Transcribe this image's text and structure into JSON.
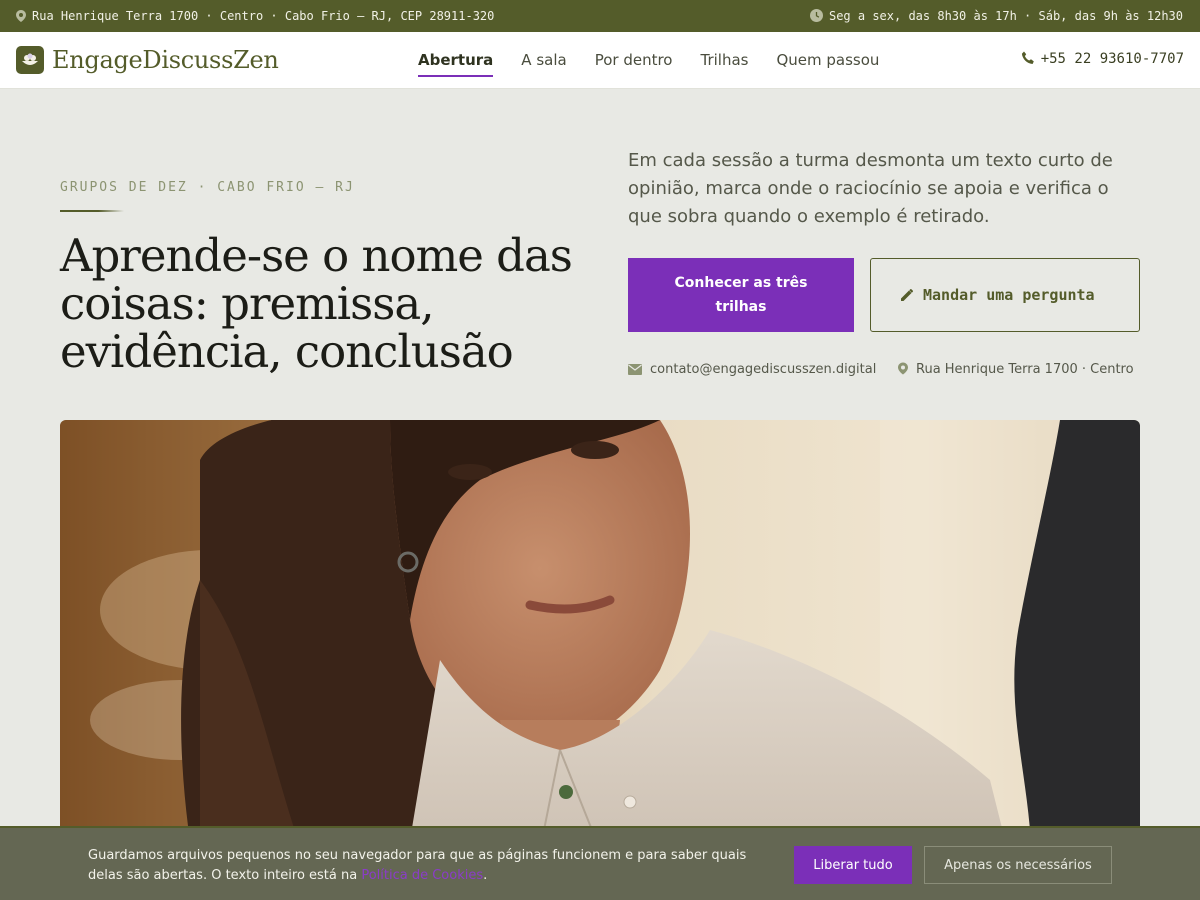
{
  "topbar": {
    "address": "Rua Henrique Terra 1700 · Centro · Cabo Frio — RJ, CEP 28911-320",
    "hours": "Seg a sex, das 8h30 às 17h · Sáb, das 9h às 12h30",
    "address_icon": "map-pin-icon",
    "hours_icon": "clock-icon"
  },
  "header": {
    "logo_text": "EngageDiscussZen",
    "logo_icon": "logo-mark-icon",
    "nav": [
      {
        "label": "Abertura",
        "active": true
      },
      {
        "label": "A sala"
      },
      {
        "label": "Por dentro"
      },
      {
        "label": "Trilhas"
      },
      {
        "label": "Quem passou"
      }
    ],
    "phone": "+55 22 93610-7707",
    "phone_icon": "phone-icon"
  },
  "hero": {
    "eyebrow": "GRUPOS DE DEZ · CABO FRIO — RJ",
    "headline": "Aprende-se o nome das coisas: premissa, evidência, conclusão",
    "intro": "Em cada sessão a turma desmonta um texto curto de opinião, marca onde o raciocínio se apoia e verifica o que sobra quando o exemplo é retirado.",
    "primary_button": "Conhecer as três trilhas",
    "secondary_button": "Mandar uma pergunta",
    "secondary_icon": "pencil-icon",
    "email": "contato@engagediscusszen.digital",
    "email_icon": "envelope-icon",
    "location": "Rua Henrique Terra 1700 · Centro",
    "location_icon": "map-pin-icon"
  },
  "cookie": {
    "text_before": "Guardamos arquivos pequenos no seu navegador para que as páginas funcionem e para saber quais delas são abertas. O texto inteiro está na ",
    "link": "Política de Cookies",
    "text_after": ".",
    "accept": "Liberar tudo",
    "necessary": "Apenas os necessários"
  },
  "colors": {
    "brand_olive": "#545c2a",
    "accent_purple": "#7b2fb8",
    "page_bg": "#e8e9e4",
    "cookie_bg": "#646753"
  }
}
